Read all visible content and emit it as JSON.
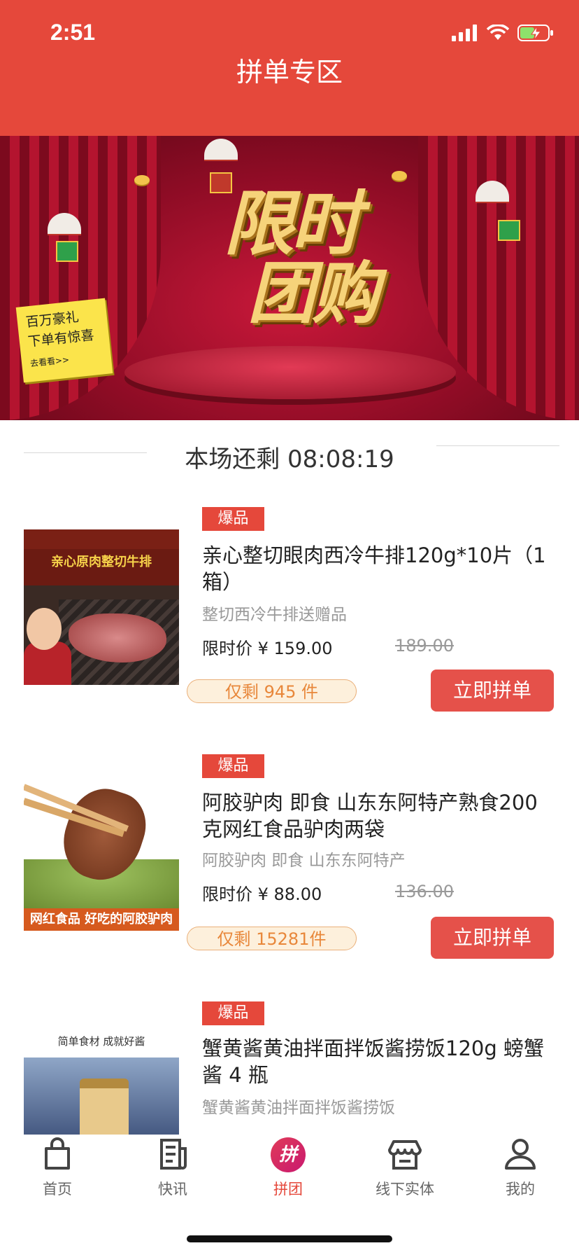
{
  "status": {
    "time": "2:51"
  },
  "header": {
    "title": "拼单专区"
  },
  "banner": {
    "title_line1": "限时",
    "title_line2": "团购",
    "card_line1": "百万豪礼",
    "card_line2": "下单有惊喜",
    "card_line3": "去看看>>"
  },
  "countdown": {
    "text": "本场还剩 08:08:19"
  },
  "products": [
    {
      "badge": "爆品",
      "title": "亲心整切眼肉西冷牛排120g*10片（1箱）",
      "subtitle": "整切西冷牛排送赠品",
      "price": "限时价 ¥ 159.00",
      "old_price": "189.00",
      "stock": "仅剩 945 件",
      "button": "立即拼单",
      "image_text": "亲心原肉整切牛排"
    },
    {
      "badge": "爆品",
      "title": "阿胶驴肉 即食 山东东阿特产熟食200克网红食品驴肉两袋",
      "subtitle": "阿胶驴肉 即食 山东东阿特产",
      "price": "限时价 ¥ 88.00",
      "old_price": "136.00",
      "stock": "仅剩 15281件",
      "button": "立即拼单",
      "image_text": "网红食品 好吃的阿胶驴肉"
    },
    {
      "badge": "爆品",
      "title": "蟹黄酱黄油拌面拌饭酱捞饭120g 螃蟹酱 4 瓶",
      "subtitle": "蟹黄酱黄油拌面拌饭酱捞饭",
      "image_text": "简单食材 成就好酱"
    }
  ],
  "tabbar": {
    "items": [
      {
        "label": "首页",
        "icon": "bag-icon"
      },
      {
        "label": "快讯",
        "icon": "news-icon"
      },
      {
        "label": "拼团",
        "icon": "pin-icon",
        "glyph": "拼"
      },
      {
        "label": "线下实体",
        "icon": "store-icon"
      },
      {
        "label": "我的",
        "icon": "user-icon"
      }
    ],
    "active_color": "#e5483b"
  },
  "colors": {
    "brand_red": "#e5483b",
    "stock_orange": "#e8873a",
    "button_red": "#e5514a"
  }
}
